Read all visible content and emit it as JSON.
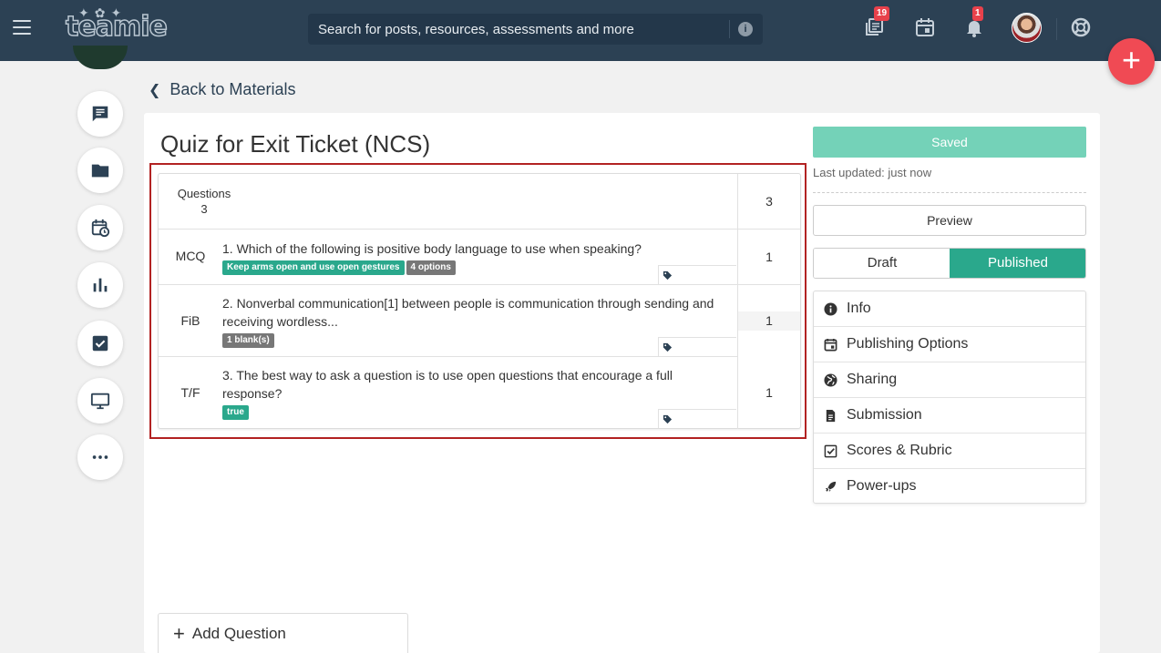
{
  "app": {
    "logo": "teamie"
  },
  "search": {
    "placeholder": "Search for posts, resources, assessments and more"
  },
  "topbar": {
    "library_badge": "19",
    "notifications_badge": "1"
  },
  "nav": {
    "back_label": "Back to Materials"
  },
  "quiz": {
    "title": "Quiz for Exit Ticket (NCS)",
    "header": {
      "label": "Questions",
      "count": "3",
      "total_points": "3"
    },
    "questions": [
      {
        "type": "MCQ",
        "text": "1. Which of the following is positive body language to use when speaking?",
        "chips": [
          "Keep arms open and use open gestures",
          "4 options"
        ],
        "points": "1"
      },
      {
        "type": "FiB",
        "text": "2. Nonverbal communication[1] between people is communication through sending and receiving wordless...",
        "chips": [
          "1 blank(s)"
        ],
        "points": "1"
      },
      {
        "type": "T/F",
        "text": "3. The best way to ask a question is to use open questions that encourage a full response?",
        "chips": [
          "true"
        ],
        "points": "1"
      }
    ],
    "add_question_label": "Add Question"
  },
  "sidebar": {
    "saved_label": "Saved",
    "last_updated": "Last updated: just now",
    "preview_label": "Preview",
    "status": {
      "draft": "Draft",
      "published": "Published",
      "selected": "Published"
    },
    "menu": [
      {
        "label": "Info",
        "icon": "info-icon"
      },
      {
        "label": "Publishing Options",
        "icon": "calendar-icon"
      },
      {
        "label": "Sharing",
        "icon": "globe-icon"
      },
      {
        "label": "Submission",
        "icon": "document-icon"
      },
      {
        "label": "Scores & Rubric",
        "icon": "checkbox-icon"
      },
      {
        "label": "Power-ups",
        "icon": "rocket-icon"
      }
    ]
  },
  "colors": {
    "topbar": "#2c4154",
    "accent": "#2aa88c",
    "saved": "#74d2b8",
    "fab": "#f04a54",
    "badge": "#e8414b"
  }
}
